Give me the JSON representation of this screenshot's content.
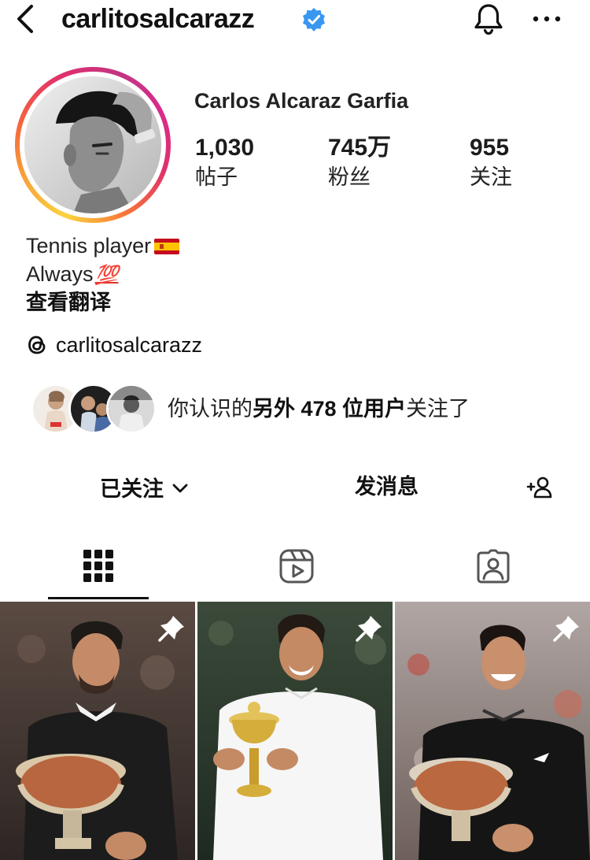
{
  "header": {
    "username": "carlitosalcarazz",
    "verified": true,
    "icons": [
      "back-icon",
      "verified-icon",
      "bell-icon",
      "more-icon"
    ]
  },
  "profile": {
    "full_name": "Carlos Alcaraz Garfia",
    "stats": [
      {
        "value": "1,030",
        "label": "帖子"
      },
      {
        "value": "745万",
        "label": "粉丝"
      },
      {
        "value": "955",
        "label": "关注"
      }
    ],
    "bio": {
      "line1": "Tennis player",
      "line1_emoji": "spain-flag",
      "line2": "Always",
      "line2_emoji": "💯",
      "translate": "查看翻译"
    },
    "threads_handle": "carlitosalcarazz"
  },
  "mutual": {
    "text_prefix": "你认识的",
    "bold_text": "另外 478 位用户",
    "text_suffix": "关注了"
  },
  "actions": {
    "following": "已关注",
    "message": "发消息"
  },
  "tabs": [
    "grid-icon",
    "reels-icon",
    "tagged-icon"
  ],
  "active_tab": 0,
  "posts": [
    {
      "pinned": true,
      "subject": "player-holding-trophy"
    },
    {
      "pinned": true,
      "subject": "player-holding-gold-trophy"
    },
    {
      "pinned": true,
      "subject": "player-holding-trophy"
    }
  ],
  "colors": {
    "verified": "#3897f0",
    "story_ring_start": "#fbd33e",
    "story_ring_end": "#c13584",
    "flag_red": "#c60b1e",
    "flag_yellow": "#ffc400"
  }
}
